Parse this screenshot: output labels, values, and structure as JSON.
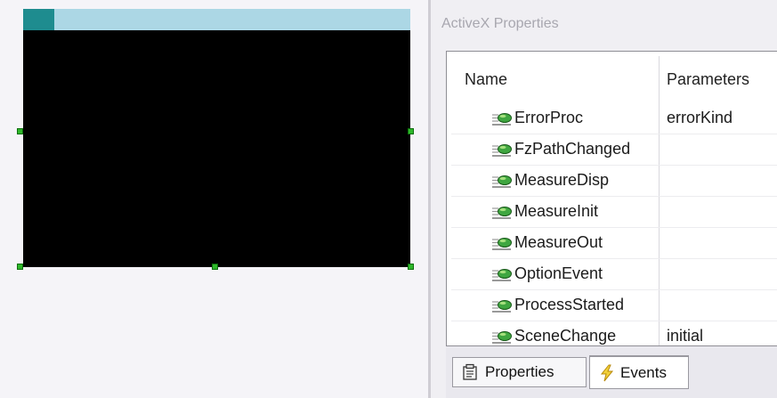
{
  "panel": {
    "title": "ActiveX Properties"
  },
  "grid": {
    "columns": [
      "Name",
      "Parameters"
    ],
    "rows": [
      {
        "name": "ErrorProc",
        "params": "errorKind"
      },
      {
        "name": "FzPathChanged",
        "params": ""
      },
      {
        "name": "MeasureDisp",
        "params": ""
      },
      {
        "name": "MeasureInit",
        "params": ""
      },
      {
        "name": "MeasureOut",
        "params": ""
      },
      {
        "name": "OptionEvent",
        "params": ""
      },
      {
        "name": "ProcessStarted",
        "params": ""
      },
      {
        "name": "SceneChange",
        "params": "initial"
      }
    ],
    "row_icon": "event-icon"
  },
  "tabs": [
    {
      "label": "Properties",
      "icon": "properties-icon",
      "selected": false
    },
    {
      "label": "Events",
      "icon": "lightning-icon",
      "selected": true
    }
  ],
  "colors": {
    "caption_bar": "#acd7e5",
    "caption_accent": "#1e8c8f",
    "control_body": "#000000",
    "selection_handle": "#2fb82b"
  }
}
